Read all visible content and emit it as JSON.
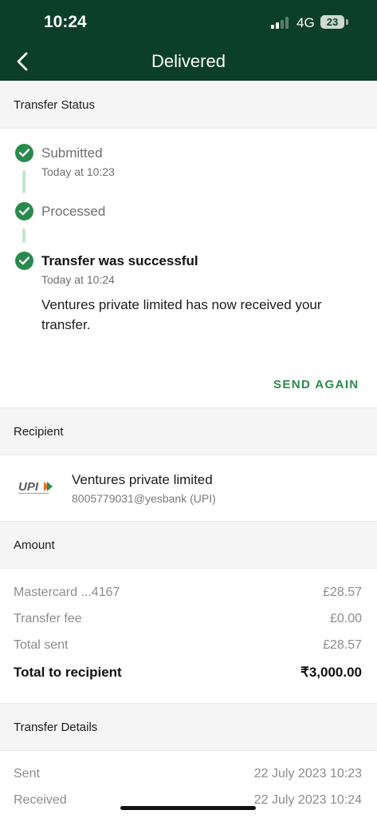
{
  "status_bar": {
    "time": "10:24",
    "network": "4G",
    "battery": "23"
  },
  "header": {
    "title": "Delivered"
  },
  "transfer_status": {
    "heading": "Transfer Status",
    "steps": [
      {
        "label": "Submitted",
        "time": "Today at 10:23"
      },
      {
        "label": "Processed"
      },
      {
        "label": "Transfer was successful",
        "time": "Today at 10:24",
        "message": "Ventures private limited has now received your transfer."
      }
    ],
    "send_again_label": "SEND AGAIN"
  },
  "recipient": {
    "heading": "Recipient",
    "name": "Ventures private limited",
    "id": "8005779031@yesbank (UPI)",
    "logo_text": "UPI"
  },
  "amount": {
    "heading": "Amount",
    "rows": [
      {
        "label": "Mastercard ...4167",
        "value": "£28.57"
      },
      {
        "label": "Transfer fee",
        "value": "£0.00"
      },
      {
        "label": "Total sent",
        "value": "£28.57"
      },
      {
        "label": "Total to recipient",
        "value": "₹3,000.00"
      }
    ]
  },
  "details": {
    "heading": "Transfer Details",
    "rows": [
      {
        "label": "Sent",
        "value": "22 July 2023 10:23"
      },
      {
        "label": "Received",
        "value": "22 July 2023 10:24"
      }
    ]
  },
  "colors": {
    "header_bg": "#0c3f2a",
    "accent_green": "#2a8a4e",
    "section_bg": "#f5f5f5"
  }
}
